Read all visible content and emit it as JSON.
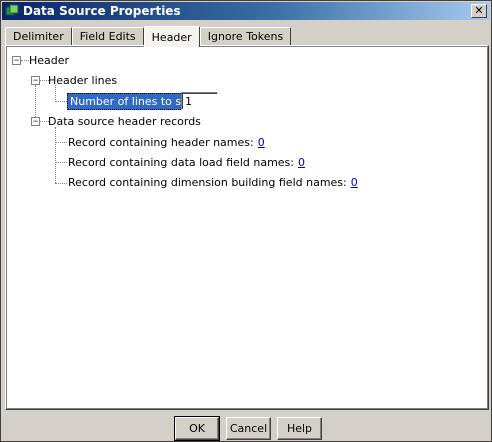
{
  "window": {
    "title": "Data Source Properties",
    "close_glyph": "✕"
  },
  "tabs": [
    {
      "label": "Delimiter"
    },
    {
      "label": "Field Edits"
    },
    {
      "label": "Header"
    },
    {
      "label": "Ignore Tokens"
    }
  ],
  "tree": {
    "root": "Header",
    "header_lines": "Header lines",
    "skip_label": "Number of lines to skip",
    "skip_value": "1",
    "header_records": "Data source header records",
    "rec_header_names": "Record containing header names:",
    "rec_header_names_value": "0",
    "rec_load_field_names": "Record containing data load field names:",
    "rec_load_field_names_value": "0",
    "rec_dim_field_names": "Record containing dimension building field names:",
    "rec_dim_field_names_value": "0",
    "collapse_glyph": "−"
  },
  "buttons": {
    "ok": "OK",
    "cancel": "Cancel",
    "help": "Help"
  },
  "colors": {
    "title_start": "#0a246a",
    "selection": "#316ac5",
    "link": "#0000cc"
  }
}
